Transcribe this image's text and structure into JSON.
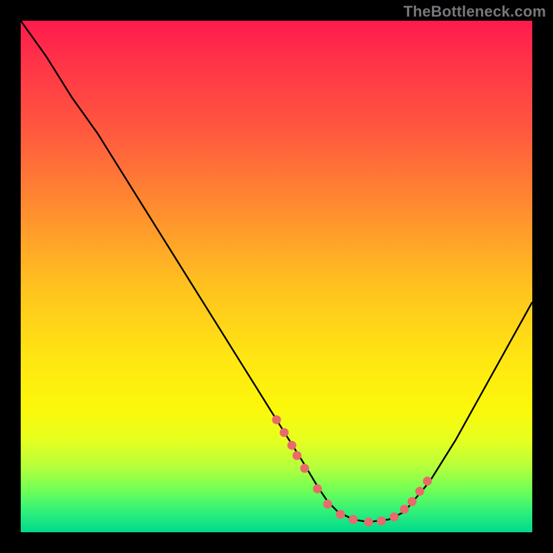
{
  "watermark": "TheBottleneck.com",
  "chart_data": {
    "type": "line",
    "title": "",
    "xlabel": "",
    "ylabel": "",
    "xlim": [
      0,
      100
    ],
    "ylim": [
      0,
      100
    ],
    "series": [
      {
        "name": "bottleneck-curve",
        "x": [
          0,
          5,
          10,
          15,
          20,
          25,
          30,
          35,
          40,
          45,
          50,
          55,
          58,
          60,
          62,
          65,
          68,
          72,
          75,
          80,
          85,
          90,
          95,
          100
        ],
        "y": [
          100,
          93,
          85,
          78,
          70,
          62,
          54,
          46,
          38,
          30,
          22,
          14,
          9,
          6,
          4,
          2.5,
          2,
          2.5,
          4,
          10,
          18,
          27,
          36,
          45
        ]
      },
      {
        "name": "highlighted-points",
        "x": [
          50.0,
          51.5,
          53.0,
          54.0,
          55.5,
          58.0,
          60.0,
          62.5,
          65.0,
          68.0,
          70.5,
          73.0,
          75.0,
          76.5,
          78.0,
          79.5
        ],
        "y": [
          22.0,
          19.5,
          17.0,
          15.0,
          12.5,
          8.5,
          5.5,
          3.5,
          2.5,
          2.0,
          2.2,
          3.0,
          4.5,
          6.0,
          8.0,
          10.0
        ]
      }
    ]
  }
}
